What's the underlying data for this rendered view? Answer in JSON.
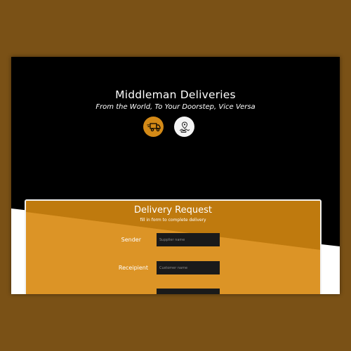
{
  "hero": {
    "title": "Middleman Deliveries",
    "subtitle": "From the World, To Your Doorstep, Vice Versa",
    "icons": [
      "delivery-truck-icon",
      "map-route-icon"
    ]
  },
  "form": {
    "title": "Delivery Request",
    "subtitle": "fill in form to complete delivery",
    "fields": [
      {
        "label": "Sender",
        "placeholder": "Supplier name",
        "value": ""
      },
      {
        "label": "Receipient",
        "placeholder": "Customer name",
        "value": ""
      },
      {
        "label": "",
        "placeholder": "",
        "value": ""
      }
    ]
  },
  "colors": {
    "page_background": "#7a5116",
    "hero_background": "#000000",
    "accent": "#d48a17",
    "card_light": "#dc9426",
    "card_dark": "#bf7a0e",
    "field_background": "#1a1a1a"
  }
}
